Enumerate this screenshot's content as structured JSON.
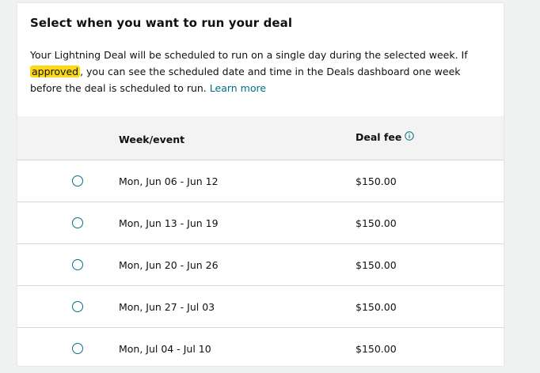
{
  "section": {
    "title": "Select when you want to run your deal",
    "desc_part1": "Your Lightning Deal will be scheduled to run on a single day during the selected week. If ",
    "desc_highlight": "approved",
    "desc_part2": ", you can see the scheduled date and time in the Deals dashboard one week before the deal is scheduled to run. ",
    "learn_more": "Learn more"
  },
  "table": {
    "headers": {
      "week": "Week/event",
      "fee": "Deal fee"
    },
    "rows": [
      {
        "week": "Mon, Jun 06 - Jun 12",
        "fee": "$150.00"
      },
      {
        "week": "Mon, Jun 13 - Jun 19",
        "fee": "$150.00"
      },
      {
        "week": "Mon, Jun 20 - Jun 26",
        "fee": "$150.00"
      },
      {
        "week": "Mon, Jun 27 - Jul 03",
        "fee": "$150.00"
      },
      {
        "week": "Mon, Jul 04 - Jul 10",
        "fee": "$150.00"
      }
    ]
  },
  "colors": {
    "accent": "#007185",
    "highlight": "#ffd814",
    "header_bg": "#f3f3f3",
    "divider": "#d5d9d9"
  },
  "icons": {
    "fee_info": "info-icon",
    "row_select": "radio-button"
  }
}
